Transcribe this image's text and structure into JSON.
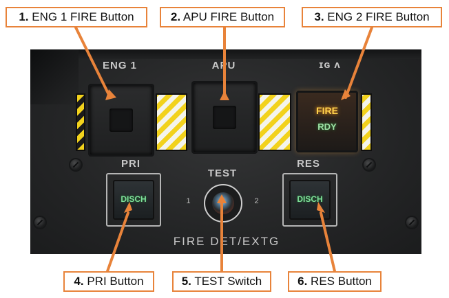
{
  "callouts": [
    {
      "num": "1.",
      "text": "ENG 1 FIRE Button"
    },
    {
      "num": "2.",
      "text": "APU FIRE Button"
    },
    {
      "num": "3.",
      "text": "ENG 2 FIRE Button"
    },
    {
      "num": "4.",
      "text": "PRI Button"
    },
    {
      "num": "5.",
      "text": "TEST Switch"
    },
    {
      "num": "6.",
      "text": "RES Button"
    }
  ],
  "panel": {
    "eng1_label": "ENG 1",
    "apu_label": "APU",
    "eng2_label_partial": "ɪɢ ᴧ",
    "fire_text": "FIRE",
    "rdy_text": "RDY",
    "pri_label": "PRI",
    "res_label": "RES",
    "test_label": "TEST",
    "test_pos_1": "1",
    "test_pos_2": "2",
    "disch_text": "DISCH",
    "panel_title": "FIRE DET/EXTG"
  },
  "colors": {
    "callout_border": "#e8833a",
    "fire_light": "#ffd34d",
    "rdy_light": "#9fe3a6",
    "disch_light": "#7fe09a",
    "hazard_yellow": "#f2d21c"
  }
}
